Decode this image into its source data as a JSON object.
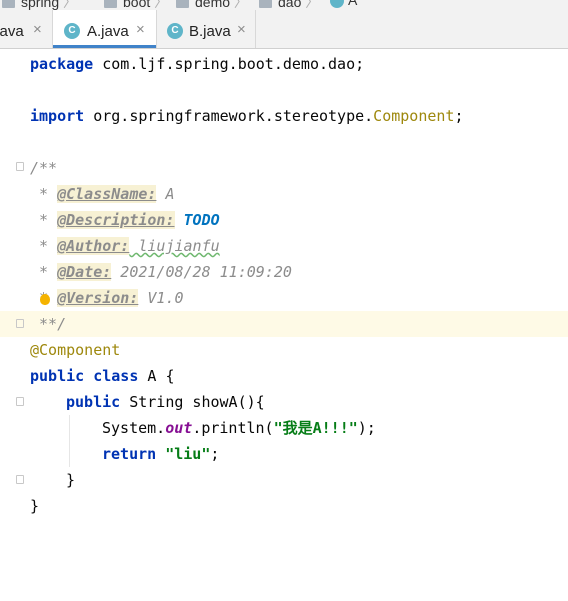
{
  "breadcrumb": [
    "spring",
    "boot",
    "demo",
    "dao",
    "A"
  ],
  "tabs": [
    {
      "label": ".java",
      "icon_letter": "",
      "active": false
    },
    {
      "label": "A.java",
      "icon_letter": "C",
      "active": true
    },
    {
      "label": "B.java",
      "icon_letter": "C",
      "active": false
    }
  ],
  "close_glyph": "×",
  "code": {
    "package": [
      "package",
      " com.ljf.spring.boot.demo.dao;"
    ],
    "import": [
      "import",
      " org.springframework.stereotype.",
      "Component",
      ";"
    ],
    "doc_open": "/**",
    "doc_prefix": " * ",
    "doc_tags": [
      {
        "tag": "@ClassName:",
        "value": " A"
      },
      {
        "tag": "@Description:",
        "value": " TODO"
      },
      {
        "tag": "@Author:",
        "value": " liujianfu"
      },
      {
        "tag": "@Date:",
        "value": " 2021/08/28 11:09:20"
      },
      {
        "tag": "@Version:",
        "value": " V1.0"
      }
    ],
    "doc_close": " **/",
    "annotation": "@Component",
    "class_decl": [
      "public",
      " ",
      "class",
      " A {"
    ],
    "method_decl": [
      "public",
      " String showA(){"
    ],
    "println": [
      "System.",
      "out",
      ".println(",
      "\"我是A!!!\"",
      ");"
    ],
    "return_stmt": [
      "return",
      " ",
      "\"liu\"",
      ";"
    ],
    "close_method": "}",
    "close_class": "}"
  }
}
